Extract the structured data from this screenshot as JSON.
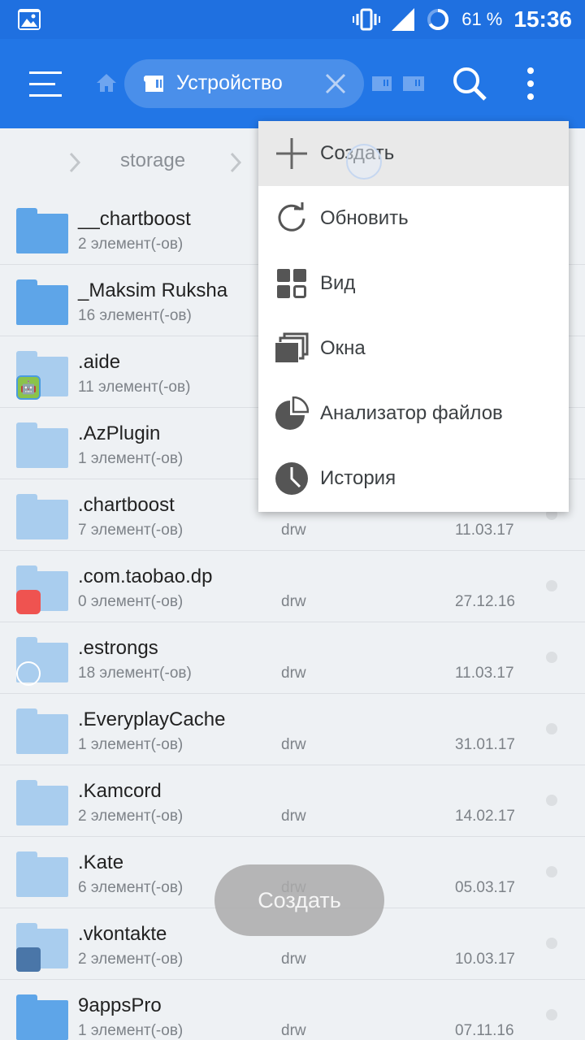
{
  "status_bar": {
    "battery_percent": "61 %",
    "time": "15:36"
  },
  "app_bar": {
    "location_chip": "Устройство",
    "colors": {
      "bar": "#2276e6",
      "status": "#1f70e0",
      "chip": "#4a8fea"
    }
  },
  "breadcrumb": {
    "path": "storage"
  },
  "files": [
    {
      "name": "__chartboost",
      "count": "2 элемент(-ов)",
      "perm": "",
      "date": "",
      "faded": false,
      "badge": ""
    },
    {
      "name": "_Maksim Ruksha",
      "count": "16 элемент(-ов)",
      "perm": "",
      "date": "",
      "faded": false,
      "badge": ""
    },
    {
      "name": ".aide",
      "count": "11 элемент(-ов)",
      "perm": "",
      "date": "",
      "faded": true,
      "badge": "android"
    },
    {
      "name": ".AzPlugin",
      "count": "1 элемент(-ов)",
      "perm": "",
      "date": "",
      "faded": true,
      "badge": ""
    },
    {
      "name": ".chartboost",
      "count": "7 элемент(-ов)",
      "perm": "drw",
      "date": "11.03.17",
      "faded": true,
      "badge": ""
    },
    {
      "name": ".com.taobao.dp",
      "count": "0 элемент(-ов)",
      "perm": "drw",
      "date": "27.12.16",
      "faded": true,
      "badge": "aliexpress"
    },
    {
      "name": ".estrongs",
      "count": "18 элемент(-ов)",
      "perm": "drw",
      "date": "11.03.17",
      "faded": true,
      "badge": "es"
    },
    {
      "name": ".EveryplayCache",
      "count": "1 элемент(-ов)",
      "perm": "drw",
      "date": "31.01.17",
      "faded": true,
      "badge": ""
    },
    {
      "name": ".Kamcord",
      "count": "2 элемент(-ов)",
      "perm": "drw",
      "date": "14.02.17",
      "faded": true,
      "badge": ""
    },
    {
      "name": ".Kate",
      "count": "6 элемент(-ов)",
      "perm": "drw",
      "date": "05.03.17",
      "faded": true,
      "badge": ""
    },
    {
      "name": ".vkontakte",
      "count": "2 элемент(-ов)",
      "perm": "drw",
      "date": "10.03.17",
      "faded": true,
      "badge": "vk"
    },
    {
      "name": "9appsPro",
      "count": "1 элемент(-ов)",
      "perm": "drw",
      "date": "07.11.16",
      "faded": false,
      "badge": ""
    }
  ],
  "menu": {
    "items": [
      {
        "label": "Создать",
        "icon": "plus-icon"
      },
      {
        "label": "Обновить",
        "icon": "refresh-icon"
      },
      {
        "label": "Вид",
        "icon": "view-grid-icon"
      },
      {
        "label": "Окна",
        "icon": "windows-icon"
      },
      {
        "label": "Анализатор файлов",
        "icon": "pie-chart-icon"
      },
      {
        "label": "История",
        "icon": "clock-icon"
      }
    ]
  },
  "toast": {
    "text": "Создать"
  }
}
